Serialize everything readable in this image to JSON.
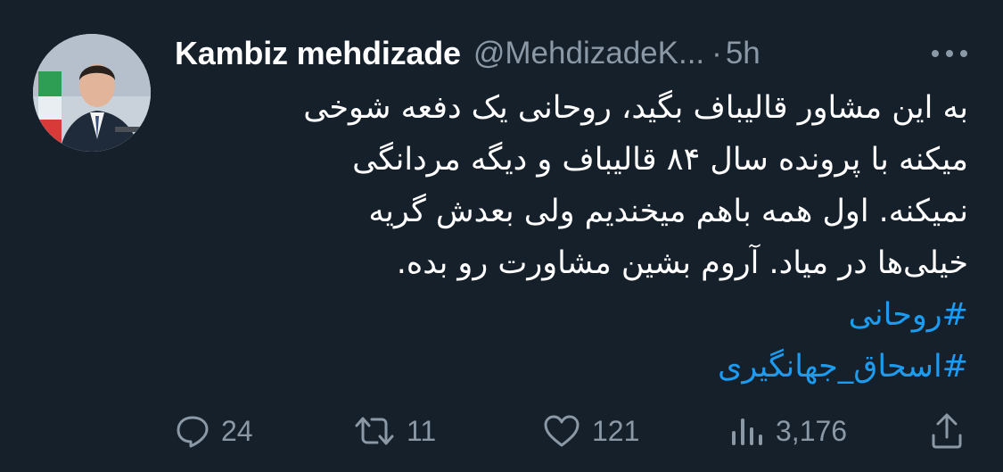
{
  "tweet": {
    "author": {
      "display_name": "Kambiz mehdizade",
      "handle": "@MehdizadeK...",
      "avatar_icon": "profile-photo"
    },
    "separator": "·",
    "time": "5h",
    "more_icon": "more-horizontal-icon",
    "text_lines": [
      "به این مشاور قالیباف بگید، روحانی یک دفعه شوخی",
      "میکنه با پرونده سال ۸۴ قالیباف و دیگه مردانگی",
      "نمیکنه. اول همه باهم میخندیم ولی بعدش گریه",
      "خیلی‌ها در میاد. آروم بشین مشاورت رو بده."
    ],
    "hashtags": [
      "#روحانی",
      "#اسحاق_جهانگیری"
    ],
    "actions": {
      "reply": {
        "icon": "reply-icon",
        "count": "24"
      },
      "retweet": {
        "icon": "retweet-icon",
        "count": "11"
      },
      "like": {
        "icon": "heart-icon",
        "count": "121"
      },
      "views": {
        "icon": "views-icon",
        "count": "3,176"
      },
      "share": {
        "icon": "share-icon"
      }
    },
    "colors": {
      "background": "#15202b",
      "text": "#ffffff",
      "secondary": "#8b98a5",
      "link": "#1d9bf0"
    }
  }
}
